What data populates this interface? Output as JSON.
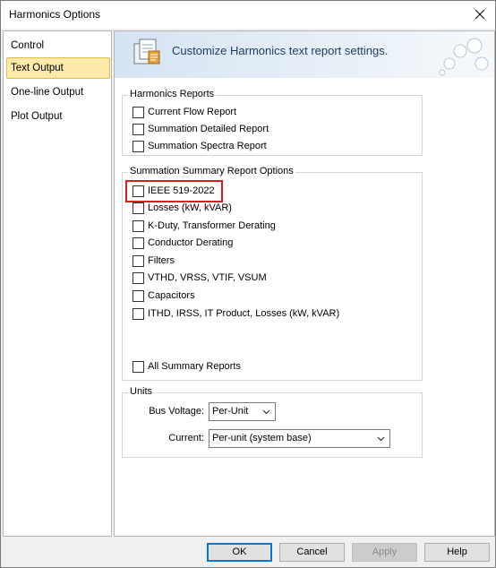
{
  "window": {
    "title": "Harmonics Options"
  },
  "sidebar": {
    "items": [
      {
        "label": "Control",
        "selected": false
      },
      {
        "label": "Text Output",
        "selected": true
      },
      {
        "label": "One-line Output",
        "selected": false
      },
      {
        "label": "Plot Output",
        "selected": false
      }
    ]
  },
  "banner": {
    "text": "Customize Harmonics text report settings."
  },
  "harmonics_reports": {
    "title": "Harmonics Reports",
    "options": [
      {
        "label": "Current Flow Report",
        "checked": false
      },
      {
        "label": "Summation Detailed Report",
        "checked": false
      },
      {
        "label": "Summation Spectra Report",
        "checked": false
      }
    ]
  },
  "summary_options": {
    "title": "Summation Summary Report Options",
    "options": [
      {
        "label": "IEEE 519-2022",
        "checked": false
      },
      {
        "label": "Losses (kW, kVAR)",
        "checked": false
      },
      {
        "label": "K-Duty, Transformer Derating",
        "checked": false
      },
      {
        "label": "Conductor Derating",
        "checked": false
      },
      {
        "label": "Filters",
        "checked": false
      },
      {
        "label": "VTHD, VRSS, VTIF, VSUM",
        "checked": false
      },
      {
        "label": "Capacitors",
        "checked": false
      },
      {
        "label": "ITHD, IRSS, IT Product, Losses (kW, kVAR)",
        "checked": false
      }
    ],
    "all": {
      "label": "All Summary Reports",
      "checked": false
    }
  },
  "units": {
    "title": "Units",
    "bus_voltage": {
      "label": "Bus Voltage:",
      "value": "Per-Unit"
    },
    "current": {
      "label": "Current:",
      "value": "Per-unit (system base)"
    }
  },
  "buttons": {
    "ok": "OK",
    "cancel": "Cancel",
    "apply": "Apply",
    "help": "Help"
  },
  "colors": {
    "highlight": "#d42020",
    "selected_nav": "#fde9a9",
    "banner_text": "#1f3c66"
  }
}
